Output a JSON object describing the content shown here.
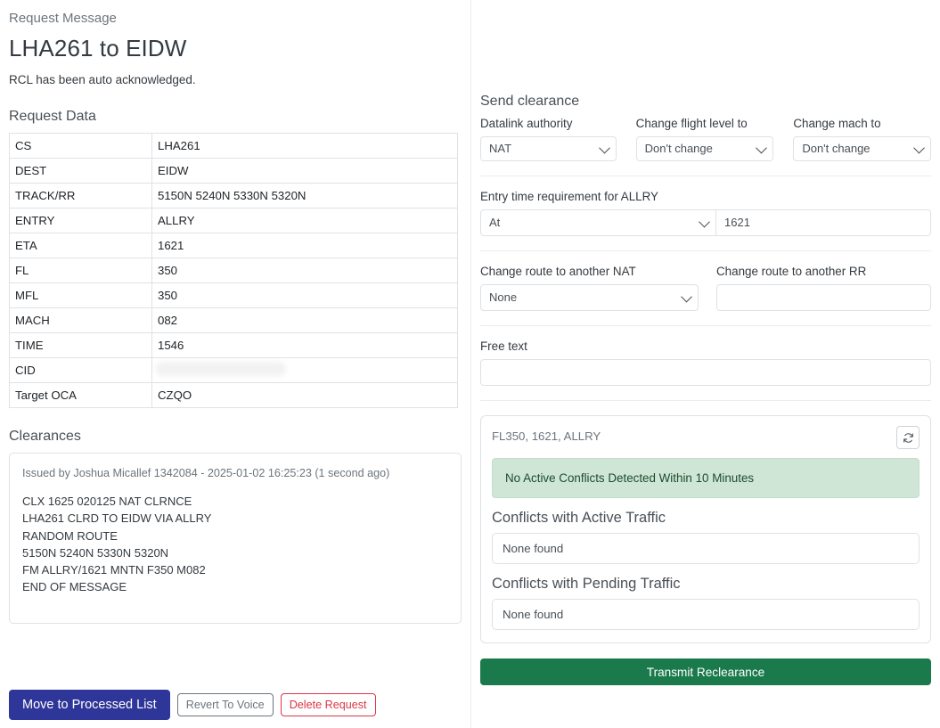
{
  "header": {
    "eyebrow": "Request Message",
    "title": "LHA261 to EIDW",
    "ack_note": "RCL has been auto acknowledged."
  },
  "request_data": {
    "heading": "Request Data",
    "rows": [
      {
        "key": "CS",
        "value": "LHA261"
      },
      {
        "key": "DEST",
        "value": "EIDW"
      },
      {
        "key": "TRACK/RR",
        "value": "5150N 5240N 5330N 5320N"
      },
      {
        "key": "ENTRY",
        "value": "ALLRY"
      },
      {
        "key": "ETA",
        "value": "1621"
      },
      {
        "key": "FL",
        "value": "350"
      },
      {
        "key": "MFL",
        "value": "350"
      },
      {
        "key": "MACH",
        "value": "082"
      },
      {
        "key": "TIME",
        "value": "1546"
      },
      {
        "key": "CID",
        "value": ""
      },
      {
        "key": "Target OCA",
        "value": "CZQO"
      }
    ]
  },
  "clearances": {
    "heading": "Clearances",
    "issued_meta": "Issued by Joshua Micallef 1342084 - 2025-01-02 16:25:23 (1 second ago)",
    "message": "CLX 1625 020125 NAT CLRNCE\nLHA261 CLRD TO EIDW VIA ALLRY\nRANDOM ROUTE\n5150N 5240N 5330N 5320N\nFM ALLRY/1621 MNTN F350 M082\nEND OF MESSAGE"
  },
  "actions": {
    "move_to_processed": "Move to Processed List",
    "revert_to_voice": "Revert To Voice",
    "delete_request": "Delete Request"
  },
  "send_clearance": {
    "heading": "Send clearance",
    "datalink_authority": {
      "label": "Datalink authority",
      "value": "NAT"
    },
    "change_flight_level": {
      "label": "Change flight level to",
      "value": "Don't change"
    },
    "change_mach": {
      "label": "Change mach to",
      "value": "Don't change"
    },
    "entry_time": {
      "label": "Entry time requirement for ALLRY",
      "condition": "At",
      "time_value": "1621"
    },
    "change_route_nat": {
      "label": "Change route to another NAT",
      "value": "None"
    },
    "change_route_rr": {
      "label": "Change route to another RR",
      "value": ""
    },
    "free_text": {
      "label": "Free text",
      "value": ""
    }
  },
  "conflicts": {
    "summary": "FL350, 1621, ALLRY",
    "refresh_icon": "refresh-icon",
    "alert": "No Active Conflicts Detected Within 10 Minutes",
    "active_heading": "Conflicts with Active Traffic",
    "active_value": "None found",
    "pending_heading": "Conflicts with Pending Traffic",
    "pending_value": "None found",
    "transmit_label": "Transmit Reclearance"
  },
  "colors": {
    "primary_blue": "#2f3699",
    "danger_red": "#dc3545",
    "success_green": "#1a7a4c",
    "alert_bg": "#cfe6d7",
    "alert_text": "#1c4b2d",
    "muted": "#6c757d",
    "border": "#dee2e6"
  }
}
